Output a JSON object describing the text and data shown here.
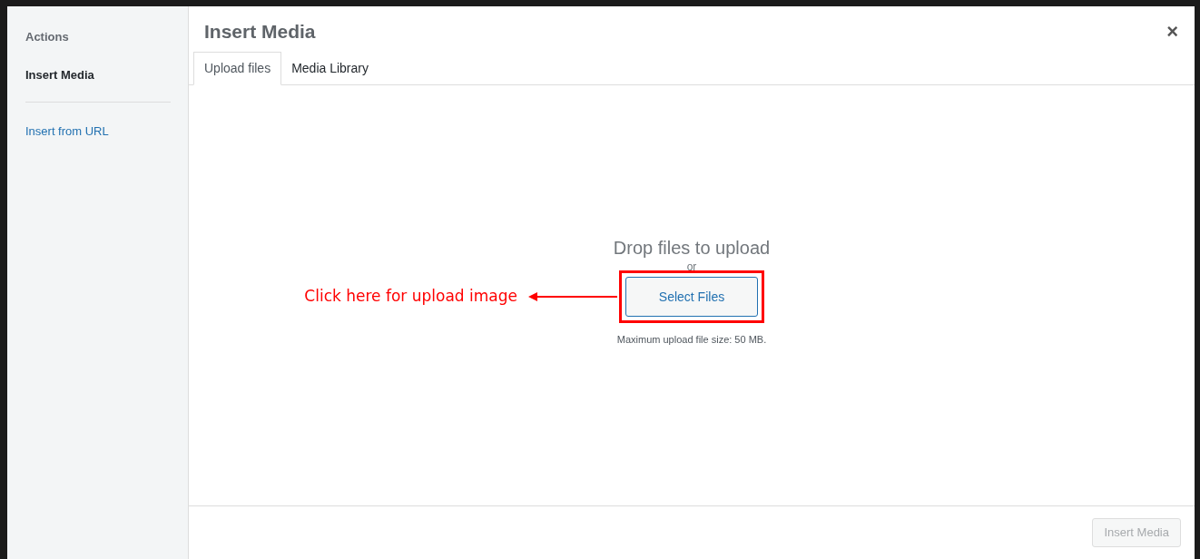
{
  "sidebar": {
    "heading": "Actions",
    "items": [
      {
        "label": "Insert Media",
        "selected": true
      },
      {
        "label": "Insert from URL",
        "selected": false
      }
    ]
  },
  "modal": {
    "title": "Insert Media",
    "close": "×"
  },
  "tabs": [
    {
      "label": "Upload files",
      "selected": true
    },
    {
      "label": "Media Library",
      "selected": false
    }
  ],
  "uploader": {
    "heading": "Drop files to upload",
    "separator": "or",
    "button": "Select Files",
    "note": "Maximum upload file size: 50 MB."
  },
  "annotation": {
    "text": "Click here for upload image"
  },
  "footer": {
    "button": {
      "label": "Insert Media",
      "disabled": true
    }
  }
}
